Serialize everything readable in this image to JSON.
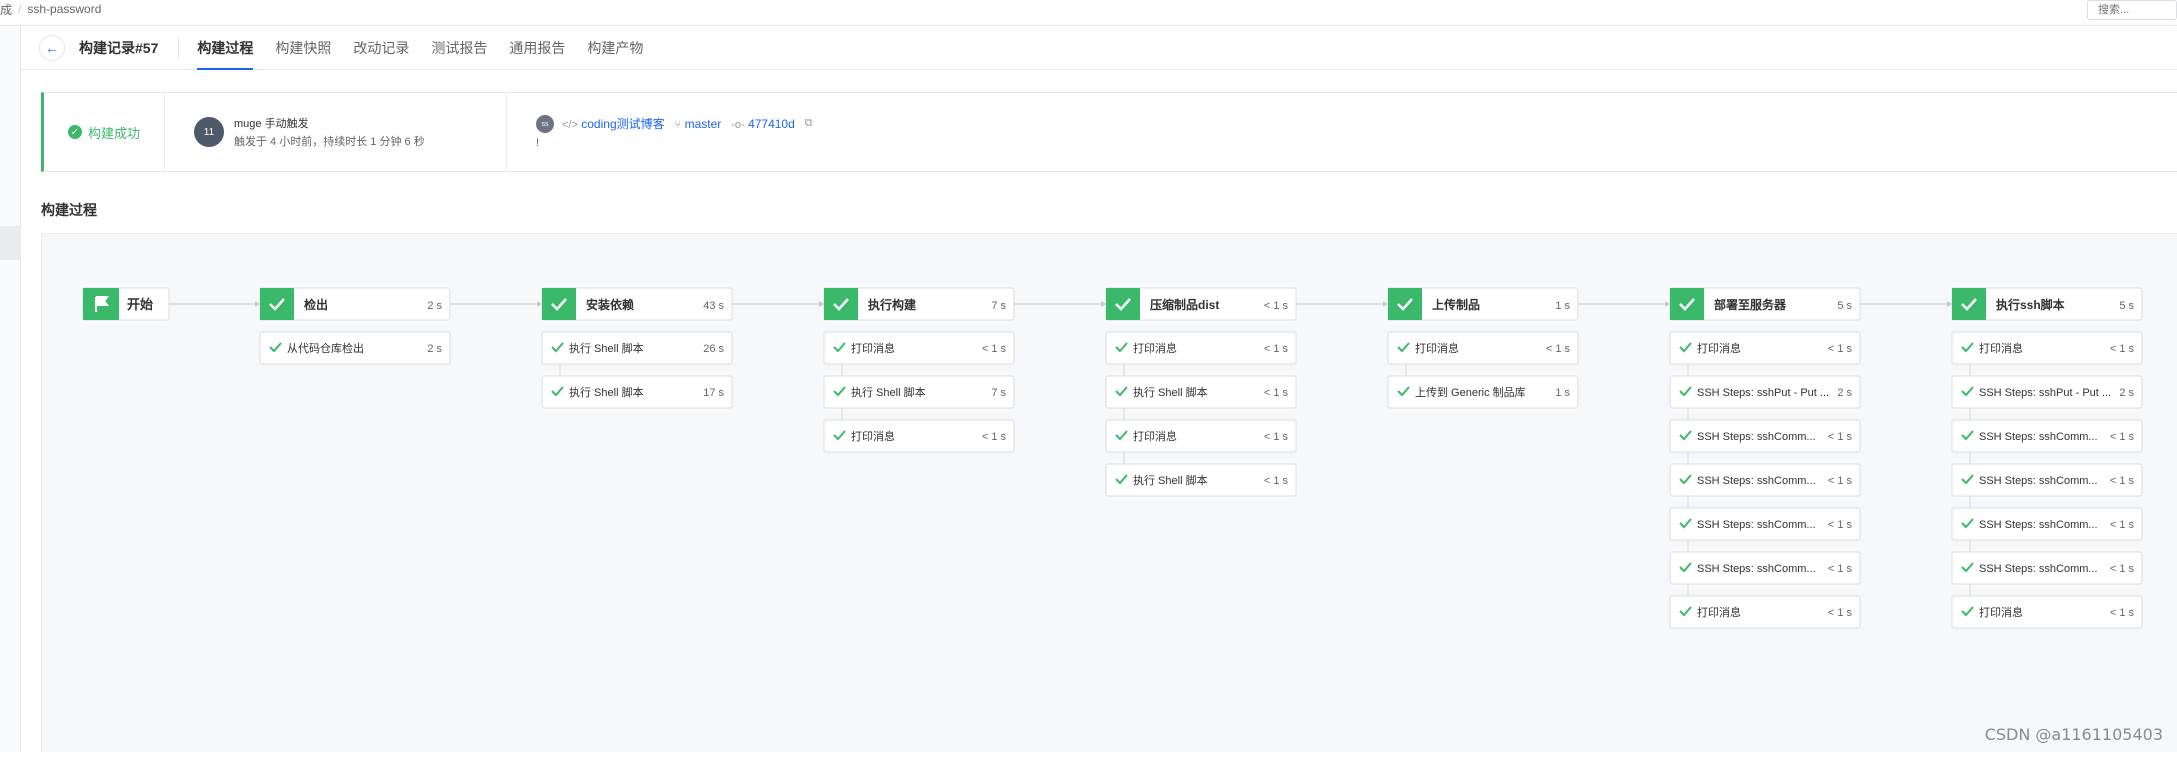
{
  "breadcrumb": {
    "prev": "成",
    "sep": "/",
    "current": "ssh-password"
  },
  "search": {
    "placeholder": "搜索..."
  },
  "header": {
    "build_title": "构建记录#57",
    "tabs": [
      {
        "label": "构建过程",
        "active": true
      },
      {
        "label": "构建快照",
        "active": false
      },
      {
        "label": "改动记录",
        "active": false
      },
      {
        "label": "测试报告",
        "active": false
      },
      {
        "label": "通用报告",
        "active": false
      },
      {
        "label": "构建产物",
        "active": false
      }
    ]
  },
  "summary": {
    "status": "构建成功",
    "avatar_text": "11",
    "trigger": "muge 手动触发",
    "trigger_detail": "触发于 4 小时前，持续时长 1 分钟 6 秒",
    "repo_avatar": "ss",
    "repo": "coding测试博客",
    "branch": "master",
    "commit": "477410d",
    "commit_message": "!"
  },
  "section_title": "构建过程",
  "colors": {
    "success": "#3bb96b",
    "accent": "#1d64f2"
  },
  "pipeline": {
    "start_label": "开始",
    "stages": [
      {
        "name": "检出",
        "duration": "2 s",
        "steps": [
          {
            "name": "从代码仓库检出",
            "duration": "2 s"
          }
        ]
      },
      {
        "name": "安装依赖",
        "duration": "43 s",
        "steps": [
          {
            "name": "执行 Shell 脚本",
            "duration": "26 s"
          },
          {
            "name": "执行 Shell 脚本",
            "duration": "17 s"
          }
        ]
      },
      {
        "name": "执行构建",
        "duration": "7 s",
        "steps": [
          {
            "name": "打印消息",
            "duration": "< 1 s"
          },
          {
            "name": "执行 Shell 脚本",
            "duration": "7 s"
          },
          {
            "name": "打印消息",
            "duration": "< 1 s"
          }
        ]
      },
      {
        "name": "压缩制品dist",
        "duration": "< 1 s",
        "steps": [
          {
            "name": "打印消息",
            "duration": "< 1 s"
          },
          {
            "name": "执行 Shell 脚本",
            "duration": "< 1 s"
          },
          {
            "name": "打印消息",
            "duration": "< 1 s"
          },
          {
            "name": "执行 Shell 脚本",
            "duration": "< 1 s"
          }
        ]
      },
      {
        "name": "上传制品",
        "duration": "1 s",
        "steps": [
          {
            "name": "打印消息",
            "duration": "< 1 s"
          },
          {
            "name": "上传到 Generic 制品库",
            "duration": "1 s"
          }
        ]
      },
      {
        "name": "部署至服务器",
        "duration": "5 s",
        "steps": [
          {
            "name": "打印消息",
            "duration": "< 1 s"
          },
          {
            "name": "SSH Steps: sshPut - Put ...",
            "duration": "2 s"
          },
          {
            "name": "SSH Steps: sshComm...",
            "duration": "< 1 s"
          },
          {
            "name": "SSH Steps: sshComm...",
            "duration": "< 1 s"
          },
          {
            "name": "SSH Steps: sshComm...",
            "duration": "< 1 s"
          },
          {
            "name": "SSH Steps: sshComm...",
            "duration": "< 1 s"
          },
          {
            "name": "打印消息",
            "duration": "< 1 s"
          }
        ]
      },
      {
        "name": "执行ssh脚本",
        "duration": "5 s",
        "steps": [
          {
            "name": "打印消息",
            "duration": "< 1 s"
          },
          {
            "name": "SSH Steps: sshPut - Put ...",
            "duration": "2 s"
          },
          {
            "name": "SSH Steps: sshComm...",
            "duration": "< 1 s"
          },
          {
            "name": "SSH Steps: sshComm...",
            "duration": "< 1 s"
          },
          {
            "name": "SSH Steps: sshComm...",
            "duration": "< 1 s"
          },
          {
            "name": "SSH Steps: sshComm...",
            "duration": "< 1 s"
          },
          {
            "name": "打印消息",
            "duration": "< 1 s"
          }
        ]
      }
    ]
  },
  "watermark": "CSDN @a1161105403"
}
